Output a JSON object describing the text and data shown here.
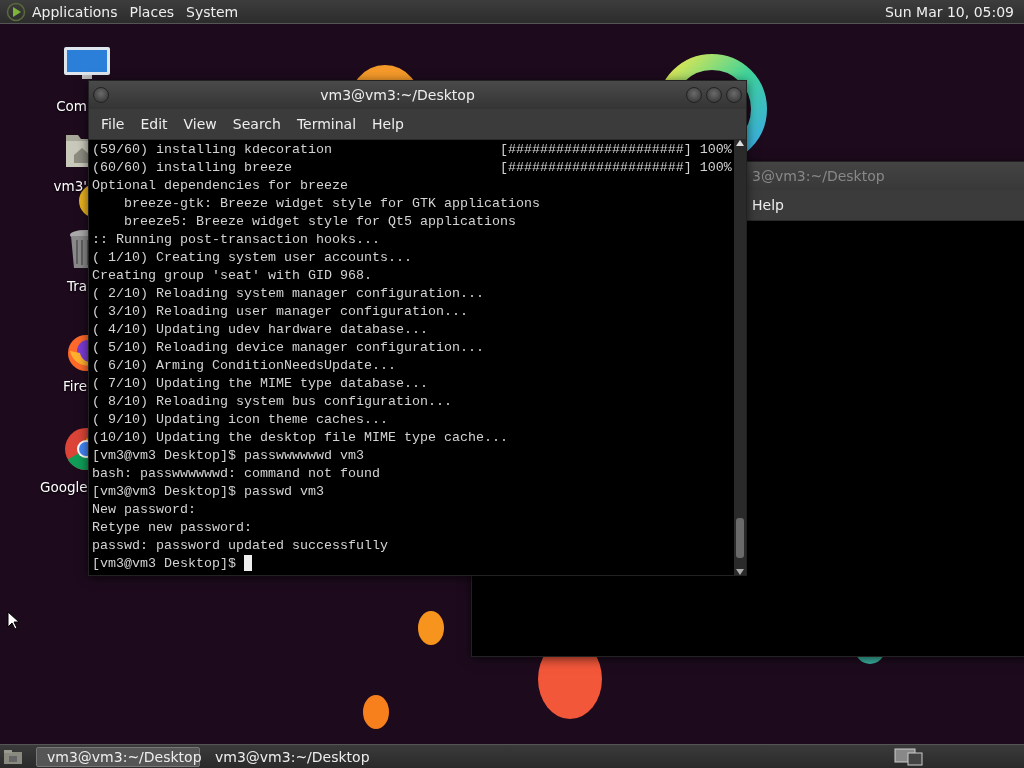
{
  "top_panel": {
    "menus": [
      "Applications",
      "Places",
      "System"
    ],
    "clock": "Sun Mar 10, 05:09"
  },
  "desktop_icons": [
    {
      "kind": "computer",
      "label": "Com"
    },
    {
      "kind": "home",
      "label": "vm3'"
    },
    {
      "kind": "trash",
      "label": "Tra"
    },
    {
      "kind": "firefox",
      "label": "Fire"
    },
    {
      "kind": "chrome",
      "label": "Google"
    }
  ],
  "back_window": {
    "title": "3@vm3:~/Desktop",
    "menus": [
      "Help"
    ]
  },
  "terminal": {
    "title": "vm3@vm3:~/Desktop",
    "menus": [
      "File",
      "Edit",
      "View",
      "Search",
      "Terminal",
      "Help"
    ],
    "cursor": true,
    "lines": [
      {
        "text": "(59/60) installing kdecoration",
        "progress": "[######################] 100%"
      },
      {
        "text": "(60/60) installing breeze",
        "progress": "[######################] 100%"
      },
      {
        "text": "Optional dependencies for breeze"
      },
      {
        "text": "    breeze-gtk: Breeze widget style for GTK applications"
      },
      {
        "text": "    breeze5: Breeze widget style for Qt5 applications"
      },
      {
        "text": ":: Running post-transaction hooks..."
      },
      {
        "text": "( 1/10) Creating system user accounts..."
      },
      {
        "text": "Creating group 'seat' with GID 968."
      },
      {
        "text": "( 2/10) Reloading system manager configuration..."
      },
      {
        "text": "( 3/10) Reloading user manager configuration..."
      },
      {
        "text": "( 4/10) Updating udev hardware database..."
      },
      {
        "text": "( 5/10) Reloading device manager configuration..."
      },
      {
        "text": "( 6/10) Arming ConditionNeedsUpdate..."
      },
      {
        "text": "( 7/10) Updating the MIME type database..."
      },
      {
        "text": "( 8/10) Reloading system bus configuration..."
      },
      {
        "text": "( 9/10) Updating icon theme caches..."
      },
      {
        "text": "(10/10) Updating the desktop file MIME type cache..."
      },
      {
        "text": "[vm3@vm3 Desktop]$ passwwwwwwd vm3"
      },
      {
        "text": "bash: passwwwwwwd: command not found"
      },
      {
        "text": "[vm3@vm3 Desktop]$ passwd vm3"
      },
      {
        "text": "New password:"
      },
      {
        "text": "Retype new password:"
      },
      {
        "text": "passwd: password updated successfully"
      },
      {
        "text": "[vm3@vm3 Desktop]$ "
      }
    ]
  },
  "taskbar": {
    "tasks": [
      {
        "label": "vm3@vm3:~/Desktop",
        "selected": true
      },
      {
        "label": "vm3@vm3:~/Desktop",
        "selected": false
      }
    ]
  }
}
